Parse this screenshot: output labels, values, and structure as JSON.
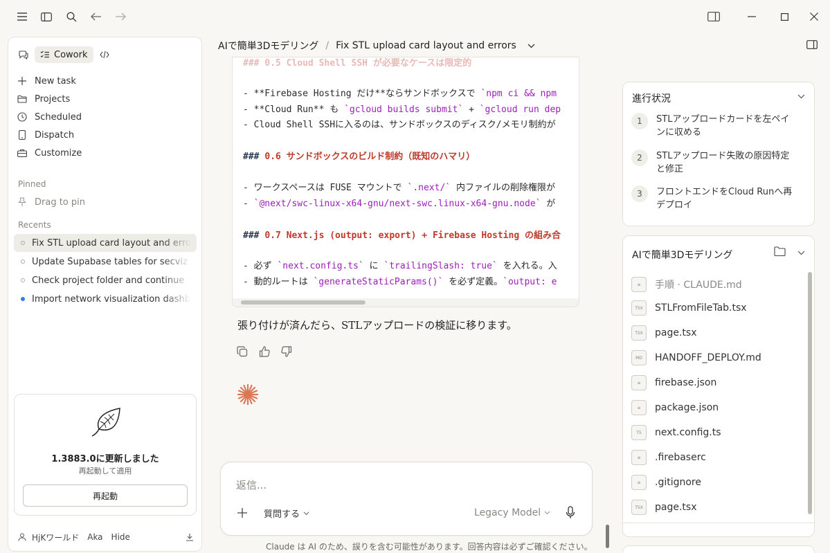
{
  "window": {
    "menu_icon": "hamburger-icon",
    "sidebar_toggle_icon": "sidebar-toggle-icon",
    "search_icon": "search-icon",
    "back_icon": "arrow-left-icon",
    "forward_icon": "arrow-right-icon",
    "panel_icon": "panel-icon",
    "minimize_icon": "minimize-icon",
    "maximize_icon": "maximize-icon",
    "close_icon": "close-icon"
  },
  "sidebar": {
    "mode_cowork": "Cowork",
    "nav": [
      {
        "label": "New task",
        "icon": "plus-icon"
      },
      {
        "label": "Projects",
        "icon": "folder-icon"
      },
      {
        "label": "Scheduled",
        "icon": "clock-icon"
      },
      {
        "label": "Dispatch",
        "icon": "phone-icon"
      },
      {
        "label": "Customize",
        "icon": "briefcase-icon"
      }
    ],
    "pinned_label": "Pinned",
    "pinned_empty": "Drag to pin",
    "recents_label": "Recents",
    "recents": [
      {
        "label": "Fix STL upload card layout and errors",
        "active": true
      },
      {
        "label": "Update Supabase tables for secviz pr"
      },
      {
        "label": "Check project folder and continue"
      },
      {
        "label": "Import network visualization dashboa",
        "status": "blue-dot"
      }
    ],
    "update": {
      "title": "1.3883.0に更新しました",
      "subtitle": "再起動して適用",
      "button": "再起動"
    },
    "user": {
      "name": "HjKワールド",
      "org": "Aka",
      "hide": "Hide"
    }
  },
  "main": {
    "breadcrumb_project": "AIで簡単3Dモデリング",
    "breadcrumb_sep": "/",
    "breadcrumb_task": "Fix STL upload card layout and errors",
    "code": {
      "line1": "### 0.5 Cloud Shell SSH が必要なケースは限定的",
      "line2a": "- **Firebase Hosting だけ**ならサンドボックスで ",
      "line2b": "`npm ci && npm",
      "line3a": "- **Cloud Run** も ",
      "line3b": "`gcloud builds submit`",
      "line3c": " + ",
      "line3d": "`gcloud run dep",
      "line4": "- Cloud Shell SSHに入るのは、サンドボックスのディスク/メモリ制約が",
      "line5a": "### ",
      "line5b": "0.6 サンドボックスのビルド制約（既知のハマリ）",
      "line6a": "- ワークスペースは FUSE マウントで ",
      "line6b": "`.next/`",
      "line6c": " 内ファイルの削除権限が",
      "line7a": "- ",
      "line7b": "`@next/swc-linux-x64-gnu/next-swc.linux-x64-gnu.node`",
      "line7c": " が",
      "line8a": "### ",
      "line8b": "0.7 Next.js (output: export) + Firebase Hosting の組み合",
      "line9a": "- 必ず ",
      "line9b": "`next.config.ts`",
      "line9c": " に ",
      "line9d": "`trailingSlash: true`",
      "line9e": " を入れる。入",
      "line10a": "- 動的ルートは ",
      "line10b": "`generateStaticParams()`",
      "line10c": " を必ず定義。",
      "line10d": "`output: e"
    },
    "reply": "張り付けが済んだら、STLアップロードの検証に移ります。",
    "actions": [
      "copy-icon",
      "thumbs-up-icon",
      "thumbs-down-icon"
    ],
    "composer": {
      "placeholder": "返信...",
      "ask": "質問する",
      "model": "Legacy Model"
    },
    "footer": "Claude は AI のため、誤りを含む可能性があります。回答内容は必ずご確認ください。"
  },
  "right": {
    "progress_title": "進行状況",
    "steps": [
      {
        "num": "1",
        "text": "STLアップロードカードを左ペインに収める"
      },
      {
        "num": "2",
        "text": "STLアップロード失敗の原因特定と修正"
      },
      {
        "num": "3",
        "text": "フロントエンドをCloud Runへ再デプロイ"
      }
    ],
    "files_title": "AIで簡単3Dモデリング",
    "files": [
      {
        "name": "手順 · CLAUDE.md",
        "type": "doc",
        "muted": true
      },
      {
        "name": "STLFromFileTab.tsx",
        "type": "TSX"
      },
      {
        "name": "page.tsx",
        "type": "TSX"
      },
      {
        "name": "HANDOFF_DEPLOY.md",
        "type": "MD"
      },
      {
        "name": "firebase.json",
        "type": "doc"
      },
      {
        "name": "package.json",
        "type": "doc"
      },
      {
        "name": "next.config.ts",
        "type": "TS"
      },
      {
        "name": ".firebaserc",
        "type": "doc"
      },
      {
        "name": ".gitignore",
        "type": "doc"
      },
      {
        "name": "page.tsx",
        "type": "TSX"
      }
    ]
  }
}
